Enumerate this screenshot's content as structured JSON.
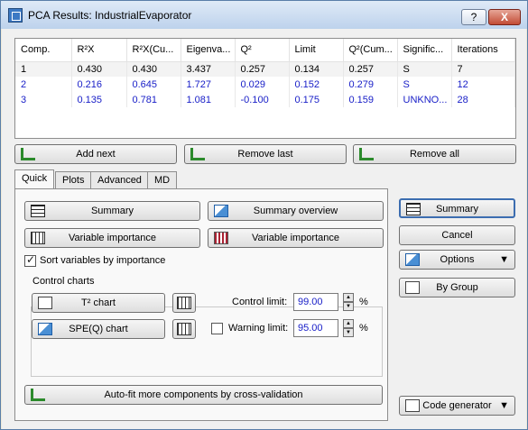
{
  "window": {
    "title": "PCA Results: IndustrialEvaporator",
    "help_label": "?",
    "close_label": "X"
  },
  "table": {
    "headers": [
      "Comp.",
      "R²X",
      "R²X(Cu...",
      "Eigenva...",
      "Q²",
      "Limit",
      "Q²(Cum...",
      "Signific...",
      "Iterations"
    ],
    "rows": [
      [
        "1",
        "0.430",
        "0.430",
        "3.437",
        "0.257",
        "0.134",
        "0.257",
        "S",
        "7"
      ],
      [
        "2",
        "0.216",
        "0.645",
        "1.727",
        "0.029",
        "0.152",
        "0.279",
        "S",
        "12"
      ],
      [
        "3",
        "0.135",
        "0.781",
        "1.081",
        "-0.100",
        "0.175",
        "0.159",
        "UNKNO...",
        "28"
      ]
    ]
  },
  "actions": {
    "add_next": "Add next",
    "remove_last": "Remove last",
    "remove_all": "Remove all"
  },
  "tabs": [
    "Quick",
    "Plots",
    "Advanced",
    "MD"
  ],
  "quick": {
    "summary": "Summary",
    "summary_overview": "Summary overview",
    "variable_importance_1": "Variable importance",
    "variable_importance_2": "Variable importance",
    "sort_label": "Sort variables by importance",
    "control_charts_label": "Control charts",
    "t2_chart": "T² chart",
    "spe_chart": "SPE(Q) chart",
    "control_limit_label": "Control limit:",
    "control_limit_value": "99.00",
    "warning_limit_label": "Warning limit:",
    "warning_limit_value": "95.00",
    "percent": "%",
    "autofit": "Auto-fit more components by cross-validation"
  },
  "side": {
    "summary": "Summary",
    "cancel": "Cancel",
    "options": "Options",
    "by_group": "By Group",
    "code_generator": "Code generator"
  }
}
